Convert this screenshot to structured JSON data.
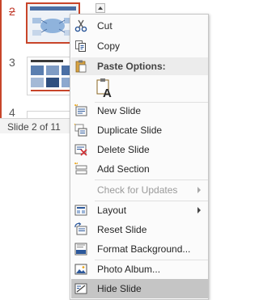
{
  "slides": {
    "numbers": [
      "2",
      "3",
      "4"
    ],
    "status_text": "Slide 2 of 11"
  },
  "menu": {
    "items": [
      {
        "label": "Cut",
        "icon": "scissors-icon"
      },
      {
        "label": "Copy",
        "icon": "copy-icon"
      },
      {
        "label": "Paste Options:",
        "icon": "clipboard-icon"
      },
      {
        "label": "New Slide",
        "icon": "new-slide-icon"
      },
      {
        "label": "Duplicate Slide",
        "icon": "duplicate-slide-icon"
      },
      {
        "label": "Delete Slide",
        "icon": "delete-slide-icon"
      },
      {
        "label": "Add Section",
        "icon": "add-section-icon"
      },
      {
        "label": "Check for Updates",
        "icon": "",
        "disabled": true,
        "submenu": true
      },
      {
        "label": "Layout",
        "icon": "layout-icon",
        "submenu": true
      },
      {
        "label": "Reset Slide",
        "icon": "reset-slide-icon"
      },
      {
        "label": "Format Background...",
        "icon": "format-background-icon"
      },
      {
        "label": "Photo Album...",
        "icon": "photo-album-icon"
      },
      {
        "label": "Hide Slide",
        "icon": "hide-slide-icon",
        "highlighted": true
      }
    ]
  },
  "colors": {
    "selection_border": "#c8452a",
    "menu_highlight": "#c5c5c5",
    "icon_blue": "#2b579a"
  }
}
